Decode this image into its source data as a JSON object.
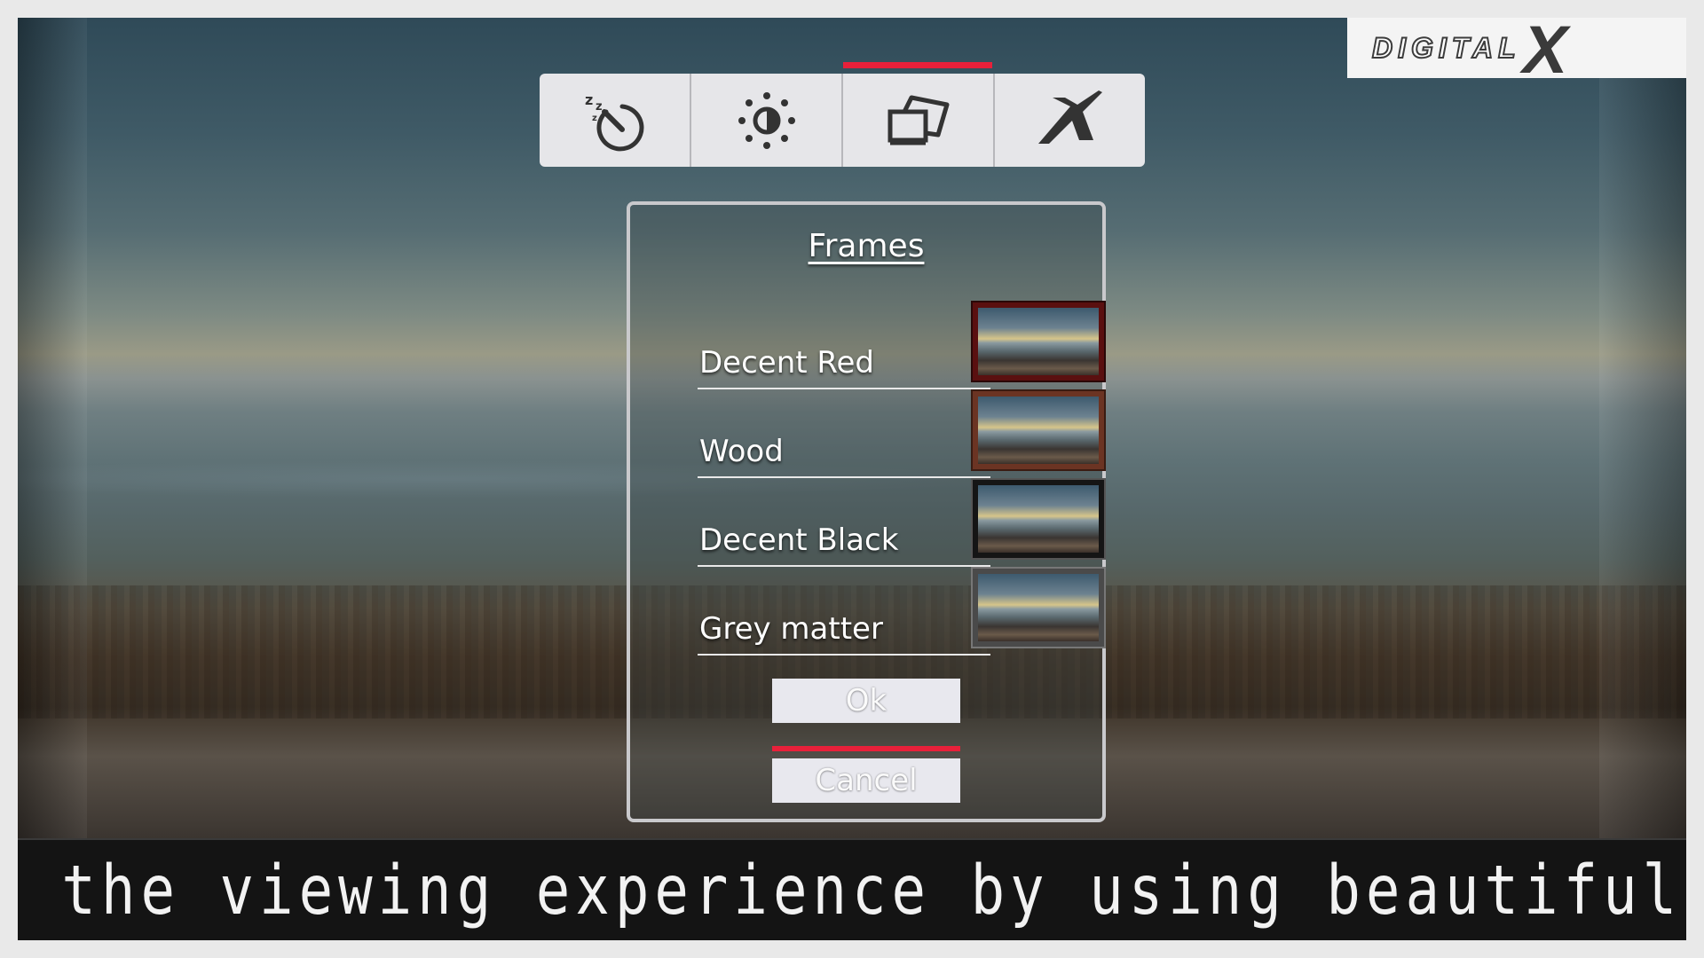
{
  "logo": {
    "text": "DIGITAL",
    "mark": "X"
  },
  "toolbar": {
    "items": [
      {
        "name": "sleep-timer",
        "icon": "sleep-timer-icon",
        "active": false
      },
      {
        "name": "brightness",
        "icon": "brightness-icon",
        "active": false
      },
      {
        "name": "frames",
        "icon": "frames-icon",
        "active": true
      },
      {
        "name": "exit",
        "icon": "x-logo-icon",
        "active": false
      }
    ],
    "active_color": "#e8203a"
  },
  "dialog": {
    "title": "Frames",
    "options": [
      {
        "label": "Decent Red",
        "frame_color": "#5a1010"
      },
      {
        "label": "Wood",
        "frame_color": "#6b3423"
      },
      {
        "label": "Decent Black",
        "frame_color": "#151515"
      },
      {
        "label": "Grey matter",
        "frame_color": "#4a4a4a"
      }
    ],
    "ok_label": "Ok",
    "cancel_label": "Cancel",
    "focused_button": "cancel"
  },
  "caption": "Enhance the viewing experience by using beautiful frames"
}
